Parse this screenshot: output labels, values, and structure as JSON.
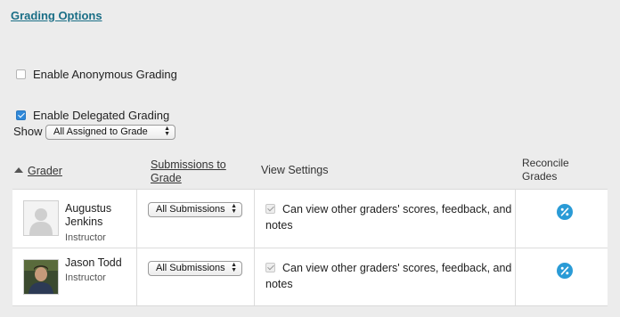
{
  "page": {
    "title": "Grading Options"
  },
  "options": {
    "anonymous_label": "Enable Anonymous Grading",
    "anonymous_checked": false,
    "delegated_label": "Enable Delegated Grading",
    "delegated_checked": true
  },
  "show": {
    "label": "Show",
    "selected": "All Assigned to Grade"
  },
  "table": {
    "headers": {
      "grader": "Grader",
      "submissions_line1": "Submissions to",
      "submissions_line2": "Grade",
      "view_settings": "View Settings",
      "reconcile_line1": "Reconcile",
      "reconcile_line2": "Grades"
    },
    "rows": [
      {
        "name_line1": "Augustus",
        "name_line2": "Jenkins",
        "role": "Instructor",
        "submissions": "All Submissions",
        "view_setting": "Can view other graders' scores, feedback, and notes",
        "view_checked": true
      },
      {
        "name_line1": "Jason Todd",
        "role": "Instructor",
        "submissions": "All Submissions",
        "view_setting": "Can view other graders' scores, feedback, and notes",
        "view_checked": true
      }
    ]
  },
  "colors": {
    "link": "#1a6e86",
    "accent": "#2f88d9",
    "reconcile": "#2a9bd6"
  },
  "icons": {
    "sort": "sort-up-icon",
    "reconcile": "percent-icon",
    "avatar_default": "default-avatar-icon"
  }
}
